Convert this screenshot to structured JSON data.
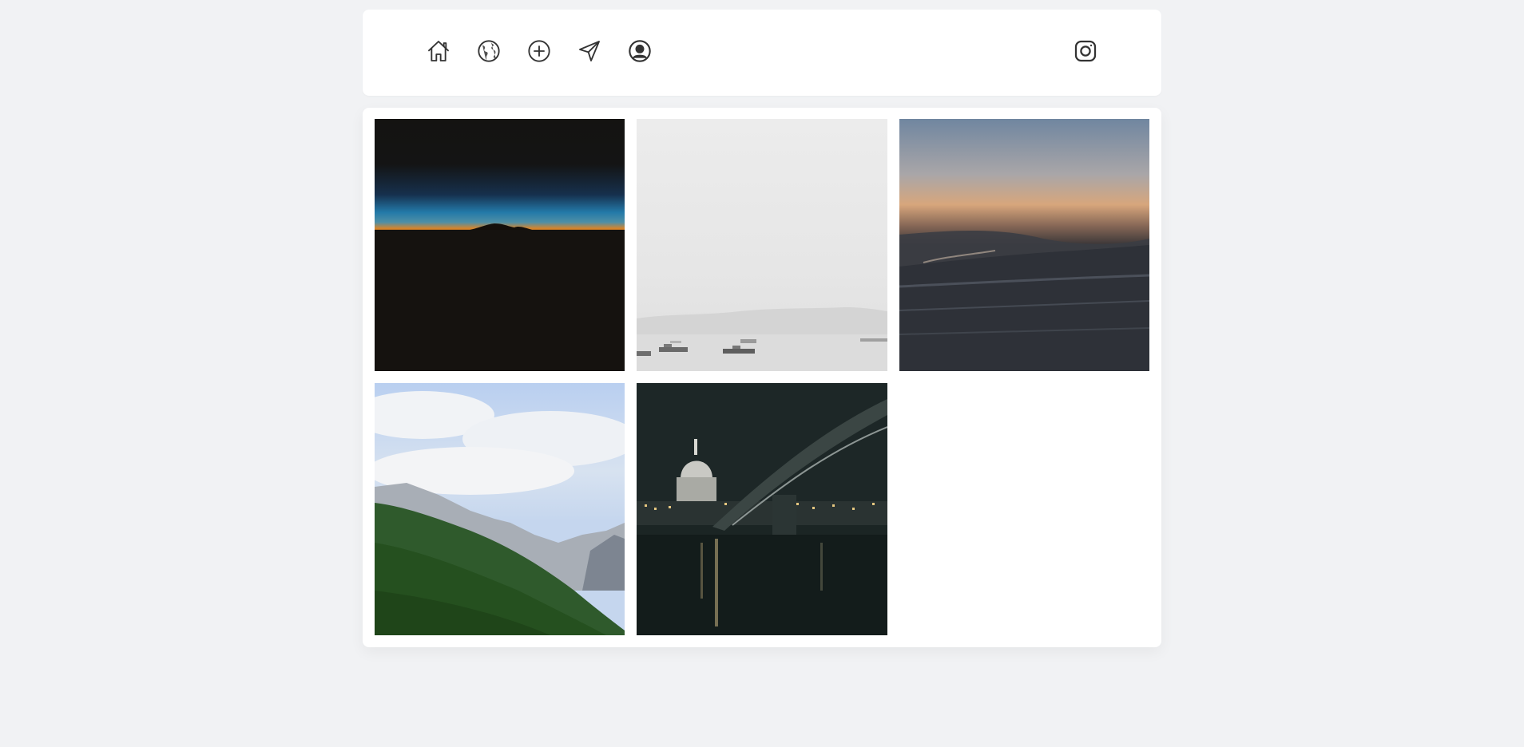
{
  "nav": {
    "items": [
      {
        "icon": "home-icon"
      },
      {
        "icon": "globe-icon"
      },
      {
        "icon": "plus-circle-icon"
      },
      {
        "icon": "send-icon"
      },
      {
        "icon": "user-circle-icon"
      }
    ],
    "external": {
      "icon": "instagram-icon"
    }
  },
  "photos": [
    {
      "subject": "mountain-silhouette-dusk"
    },
    {
      "subject": "foggy-harbor-boats"
    },
    {
      "subject": "ocean-wave-sunset"
    },
    {
      "subject": "forested-mountain-clouds"
    },
    {
      "subject": "st-pauls-millennium-bridge-night"
    }
  ],
  "colors": {
    "background": "#f1f2f4",
    "card": "#ffffff",
    "icon_stroke": "#333333"
  }
}
